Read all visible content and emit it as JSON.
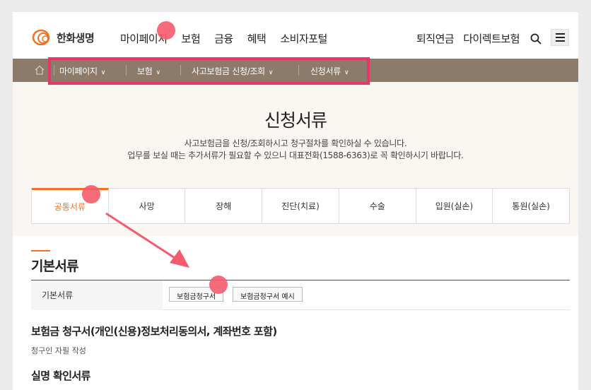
{
  "header": {
    "logo_text": "한화생명",
    "nav": [
      "마이페이지",
      "보험",
      "금융",
      "혜택",
      "소비자포털"
    ],
    "util": [
      "퇴직연금",
      "다이렉트보험"
    ]
  },
  "breadcrumb": {
    "items": [
      "마이페이지",
      "보험",
      "사고보험금 신청/조회",
      "신청서류"
    ]
  },
  "hero": {
    "title": "신청서류",
    "desc_line1": "사고보험금을 신청/조회하시고 청구절차를 확인하실 수 있습니다.",
    "desc_line2": "업무를 보실 때는 추가서류가 필요할 수 있으니 대표전화(1588-6363)로 꼭 확인하시기 바랍니다."
  },
  "tabs": [
    "공통서류",
    "사망",
    "장해",
    "진단(치료)",
    "수술",
    "입원(실손)",
    "통원(실손)"
  ],
  "active_tab": "공통서류",
  "section": {
    "title": "기본서류",
    "row_label": "기본서류",
    "btn1": "보험금청구서",
    "btn2": "보험금청구서 예시",
    "form_title": "보험금 청구서(개인(신용)정보처리동의서, 계좌번호 포함)",
    "form_sub": "청구인 자필 작성",
    "next_title": "실명 확인서류"
  },
  "colors": {
    "accent": "#f07323",
    "locbar": "#8c7a6b",
    "highlight": "#e8366a",
    "marker": "#f45b6c",
    "hero_bg": "#faf6f2"
  }
}
